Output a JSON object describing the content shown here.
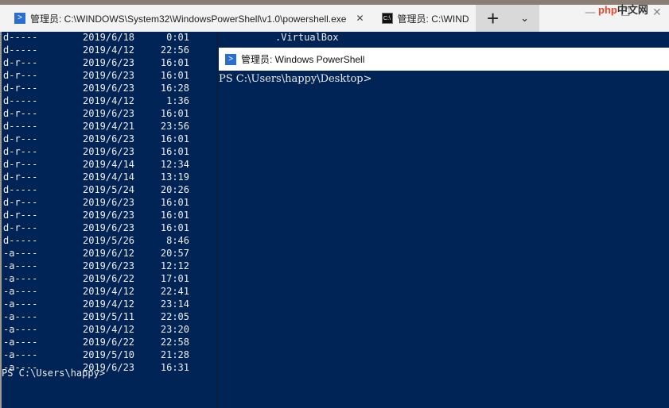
{
  "tabs": [
    {
      "title": "管理员: C:\\WINDOWS\\System32\\WindowsPowerShell\\v1.0\\powershell.exe",
      "icon": "powershell-icon"
    },
    {
      "title": "管理员: C:\\WIND",
      "icon": "cmd-icon"
    }
  ],
  "new_tab": "+",
  "dropdown": "⌄",
  "close": "✕",
  "window_controls": {
    "minimize": "—",
    "maximize": "☐",
    "close": "✕"
  },
  "watermark": "php中文网",
  "left_pane": {
    "rows": [
      [
        "d-----",
        "2019/6/18",
        "0:01"
      ],
      [
        "d-----",
        "2019/4/12",
        "22:56"
      ],
      [
        "d-r---",
        "2019/6/23",
        "16:01"
      ],
      [
        "d-r---",
        "2019/6/23",
        "16:01"
      ],
      [
        "d-r---",
        "2019/6/23",
        "16:28"
      ],
      [
        "d-----",
        "2019/4/12",
        "1:36"
      ],
      [
        "d-r---",
        "2019/6/23",
        "16:01"
      ],
      [
        "d-----",
        "2019/4/21",
        "23:56"
      ],
      [
        "d-r---",
        "2019/6/23",
        "16:01"
      ],
      [
        "d-r---",
        "2019/6/23",
        "16:01"
      ],
      [
        "d-r---",
        "2019/4/14",
        "12:34"
      ],
      [
        "d-r---",
        "2019/4/14",
        "13:19"
      ],
      [
        "d-----",
        "2019/5/24",
        "20:26"
      ],
      [
        "d-r---",
        "2019/6/23",
        "16:01"
      ],
      [
        "d-r---",
        "2019/6/23",
        "16:01"
      ],
      [
        "d-r---",
        "2019/6/23",
        "16:01"
      ],
      [
        "d-----",
        "2019/5/26",
        "8:46"
      ],
      [
        "-a----",
        "2019/6/12",
        "20:57"
      ],
      [
        "-a----",
        "2019/6/23",
        "12:12"
      ],
      [
        "-a----",
        "2019/6/22",
        "17:01"
      ],
      [
        "-a----",
        "2019/4/12",
        "22:41"
      ],
      [
        "-a----",
        "2019/4/12",
        "23:14"
      ],
      [
        "-a----",
        "2019/5/11",
        "22:05"
      ],
      [
        "-a----",
        "2019/4/12",
        "23:20"
      ],
      [
        "-a----",
        "2019/6/22",
        "22:58"
      ],
      [
        "-a----",
        "2019/5/10",
        "21:28"
      ],
      [
        "-a----",
        "2019/6/23",
        "16:31"
      ]
    ],
    "first_name": ".VirtualBox",
    "prompt": "PS C:\\Users\\happy>"
  },
  "right_pane": {
    "title": "管理员: Windows PowerShell",
    "prompt": "PS C:\\Users\\happy\\Desktop>"
  }
}
